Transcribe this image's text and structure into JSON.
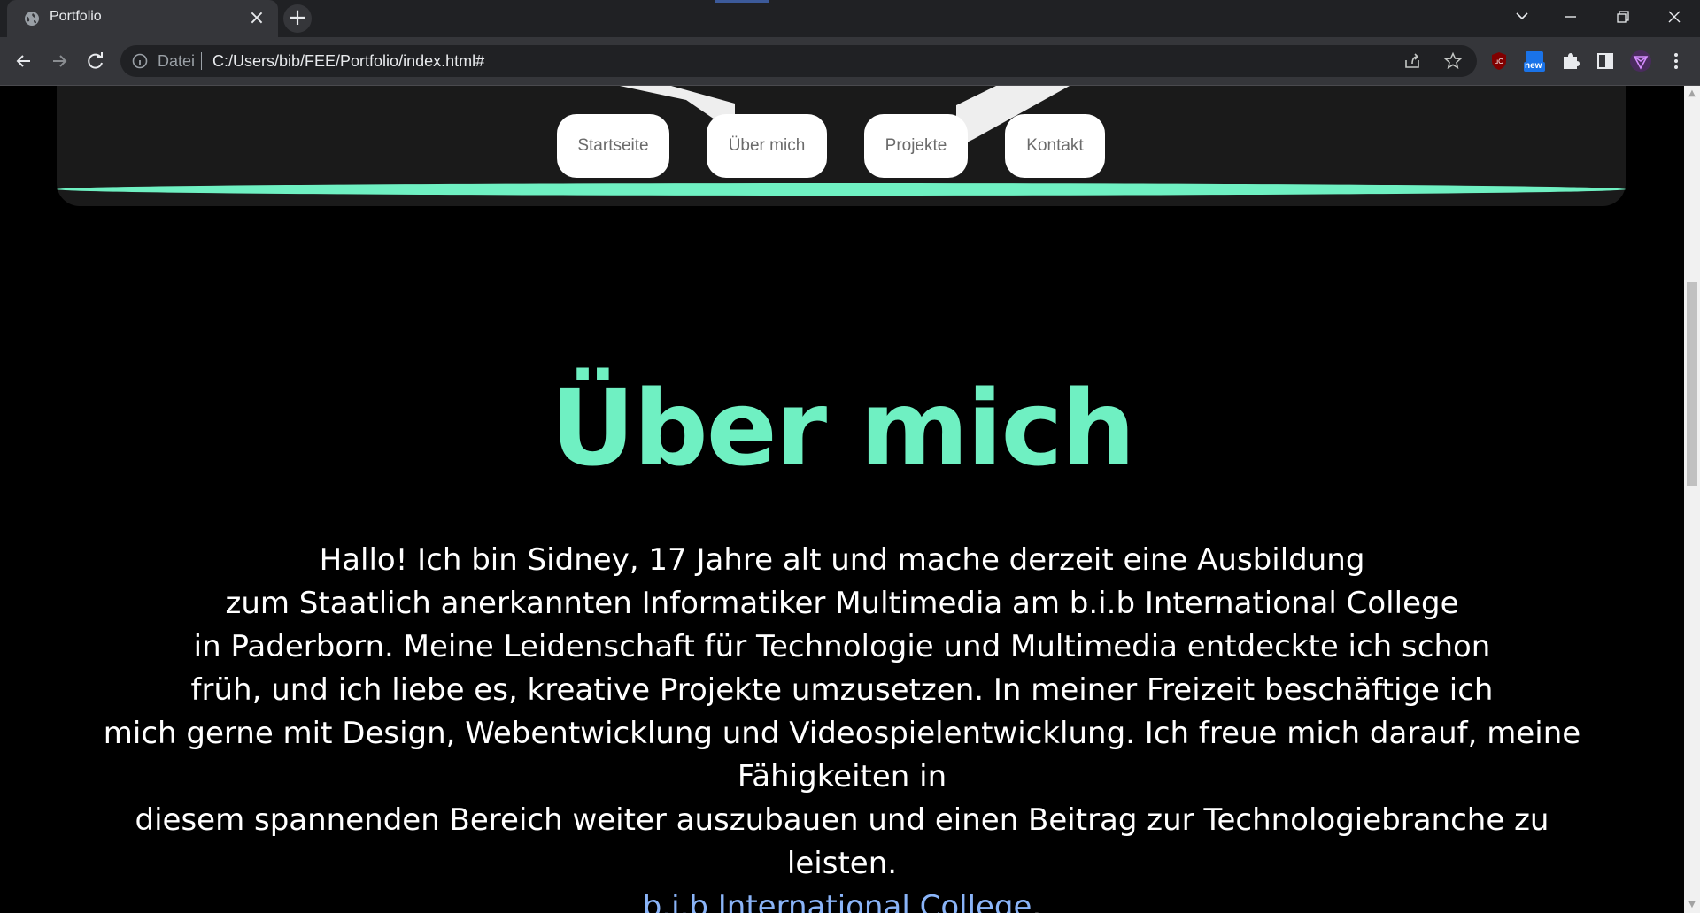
{
  "browser": {
    "tab_title": "Portfolio",
    "tab_close": "×",
    "new_tab": "+",
    "scheme_label": "Datei",
    "url": "C:/Users/bib/FEE/Portfolio/index.html#",
    "extension_badge": "new"
  },
  "nav": {
    "items": [
      {
        "label": "Startseite"
      },
      {
        "label": "Über mich"
      },
      {
        "label": "Projekte"
      },
      {
        "label": "Kontakt"
      }
    ]
  },
  "main": {
    "heading": "Über mich",
    "lines": [
      "Hallo! Ich bin Sidney, 17 Jahre alt und mache derzeit eine Ausbildung",
      "zum Staatlich anerkannten Informatiker Multimedia am b.i.b International College",
      "in Paderborn. Meine Leidenschaft für Technologie und Multimedia entdeckte ich schon",
      "früh, und ich liebe es, kreative Projekte umzusetzen. In meiner Freizeit beschäftige ich",
      "mich gerne mit Design, Webentwicklung und Videospielentwicklung. Ich freue mich darauf, meine Fähigkeiten in",
      "diesem spannenden Bereich weiter auszubauen und einen Beitrag zur Technologiebranche zu leisten."
    ],
    "link_text": "b.i.b International College",
    "link_suffix": "."
  },
  "colors": {
    "accent": "#6ff0c2",
    "link": "#8ab4f8",
    "background": "#000000"
  }
}
